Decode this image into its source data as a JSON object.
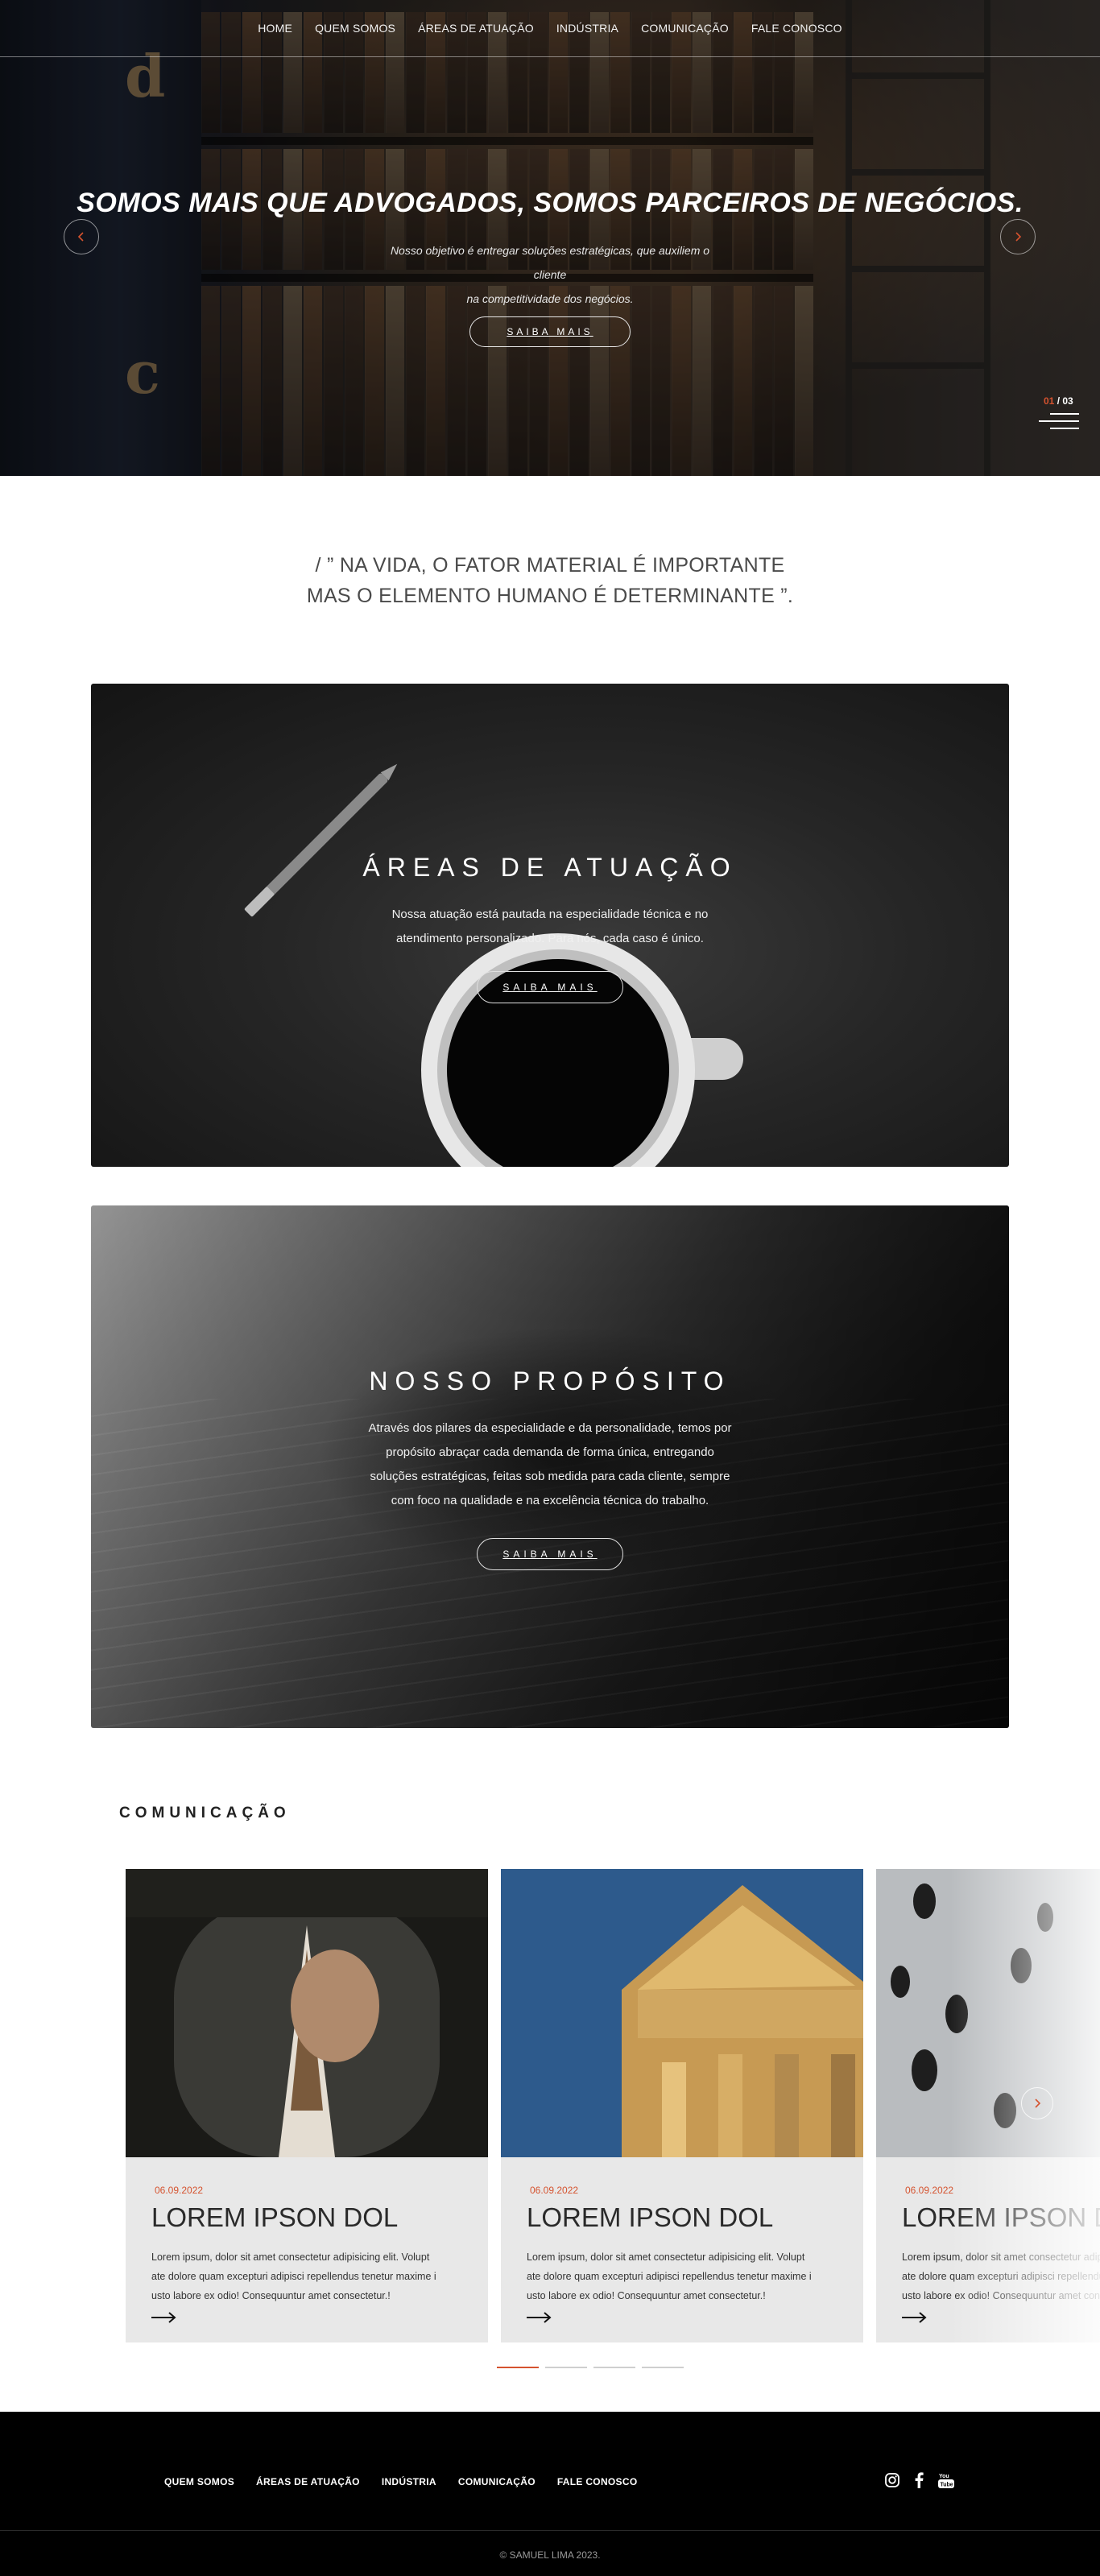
{
  "nav": {
    "items": [
      "HOME",
      "QUEM SOMOS",
      "ÁREAS DE ATUAÇÃO",
      "INDÚSTRIA",
      "COMUNICAÇÃO",
      "FALE CONOSCO"
    ]
  },
  "hero": {
    "title": "SOMOS MAIS QUE ADVOGADOS, SOMOS PARCEIROS DE NEGÓCIOS.",
    "subtitle_line1": "Nosso objetivo é entregar soluções estratégicas, que auxiliem o cliente",
    "subtitle_line2": "na competitividade dos negócios.",
    "button": "SAIBA MAIS",
    "slide_current": "01",
    "slide_separator": " / ",
    "slide_total": "03",
    "prev_icon": "chevron-left",
    "next_icon": "chevron-right",
    "spine_letters": [
      "d",
      "c"
    ]
  },
  "quote": {
    "line1": "/ ” NA VIDA, O FATOR MATERIAL É IMPORTANTE",
    "line2": "MAS O ELEMENTO HUMANO É DETERMINANTE ”."
  },
  "features": [
    {
      "title": "ÁREAS DE ATUAÇÃO",
      "text_line1": "Nossa atuação está pautada na especialidade técnica e no",
      "text_line2": "atendimento personalizado. Para nós, cada caso é único.",
      "button": "SAIBA MAIS"
    },
    {
      "title": "NOSSO PROPÓSITO",
      "text_line1": "Através dos pilares da especialidade e da personalidade, temos por",
      "text_line2": "propósito abraçar cada demanda de forma única, entregando",
      "text_line3": "soluções estratégicas, feitas sob medida para cada cliente, sempre",
      "text_line4": "com foco na qualidade e na excelência técnica do trabalho.",
      "button": "SAIBA MAIS"
    }
  ],
  "communication": {
    "title": "COMUNICAÇÃO",
    "posts": [
      {
        "date": "06.09.2022",
        "title": "LOREM IPSON DOL",
        "excerpt_line1": "Lorem ipsum, dolor sit amet consectetur adipisicing elit. Volupt",
        "excerpt_line2": "ate dolore quam excepturi adipisci repellendus tenetur maxime i",
        "excerpt_line3": "usto labore ex odio! Consequuntur amet consectetur.!"
      },
      {
        "date": "06.09.2022",
        "title": "LOREM IPSON DOL",
        "excerpt_line1": "Lorem ipsum, dolor sit amet consectetur adipisicing elit. Volupt",
        "excerpt_line2": "ate dolore quam excepturi adipisci repellendus tenetur maxime i",
        "excerpt_line3": "usto labore ex odio! Consequuntur amet consectetur.!"
      },
      {
        "date": "06.09.2022",
        "title": "LOREM IPSON DOL",
        "excerpt_line1": "Lorem ipsum, dolor sit amet consectetur adipisicing elit. Volupt",
        "excerpt_line2": "ate dolore quam excepturi adipisci repellendus tenetur maxime i",
        "excerpt_line3": "usto labore ex odio! Consequuntur amet consectetur.!"
      }
    ],
    "dots_total": 4,
    "dots_active": 1
  },
  "footer": {
    "nav": [
      "QUEM SOMOS",
      "ÁREAS DE ATUAÇÃO",
      "INDÚSTRIA",
      "COMUNICAÇÃO",
      "FALE CONOSCO"
    ],
    "socials": [
      "instagram-icon",
      "facebook-icon",
      "youtube-icon"
    ],
    "copyright": "© SAMUEL LIMA 2023."
  },
  "colors": {
    "accent": "#d5532f",
    "footer_bg": "#000000",
    "card_bg": "#e8e8e8"
  }
}
